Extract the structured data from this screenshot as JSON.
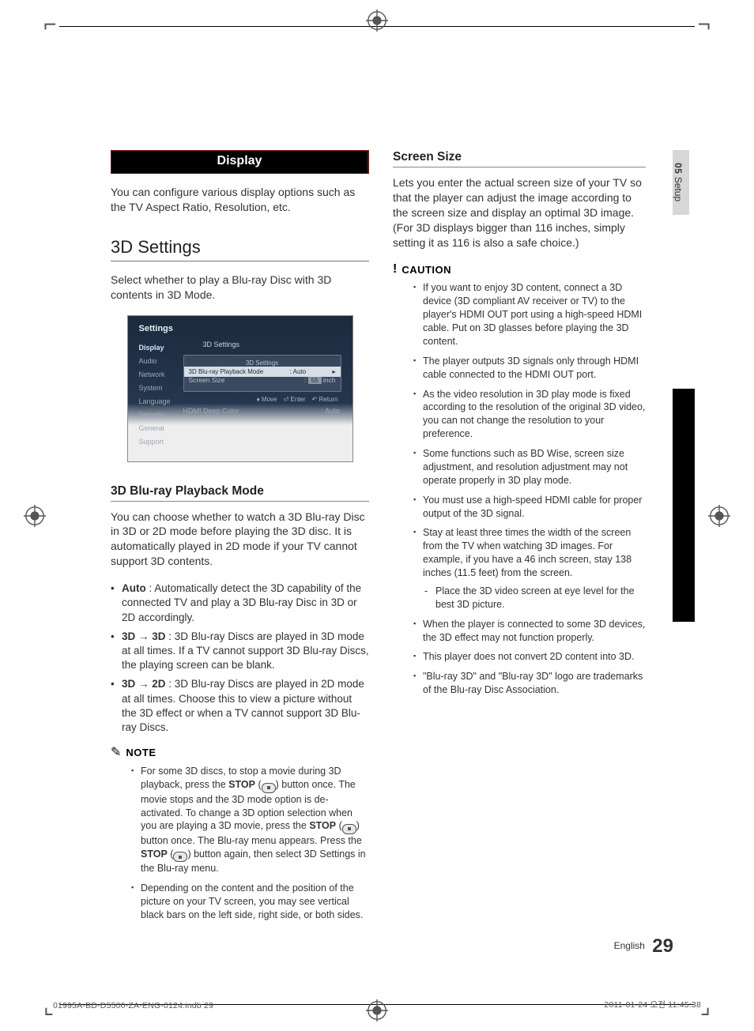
{
  "chapter": {
    "num": "05",
    "name": "Setup"
  },
  "left": {
    "banner": "Display",
    "intro": "You can configure various display options such as the TV Aspect Ratio, Resolution, etc.",
    "h2": "3D Settings",
    "body1": "Select whether to play a Blu-ray Disc with 3D contents in 3D Mode.",
    "osd": {
      "title": "Settings",
      "nav": [
        "Display",
        "Audio",
        "Network",
        "System",
        "Language",
        "Security",
        "General",
        "Support"
      ],
      "crumb": "3D Settings",
      "panel_title": "3D Settings",
      "row1_label": "3D Blu-ray Playback Mode",
      "row1_value": ": Auto",
      "row2_label": "Screen Size",
      "row2_val": "55",
      "row2_unit": "inch",
      "hints": {
        "move": "Move",
        "enter": "Enter",
        "return": "Return"
      },
      "extra_label": "HDMI Deep Color",
      "extra_value": ": Auto"
    },
    "h3a": "3D Blu-ray Playback Mode",
    "body2": "You can choose whether to watch a 3D Blu-ray Disc in 3D or 2D mode before playing the 3D disc. It is automatically played in 2D mode if your TV cannot support 3D contents.",
    "bullets": [
      {
        "label": "Auto",
        "text": " : Automatically detect the 3D capability of the connected TV and play a 3D Blu-ray Disc in 3D or 2D accordingly."
      },
      {
        "label": "3D → 3D",
        "text": " : 3D Blu-ray Discs are played in 3D mode at all times. If a TV cannot support 3D Blu-ray Discs, the playing screen can be blank."
      },
      {
        "label": "3D → 2D",
        "text": " : 3D Blu-ray Discs are played in 2D mode at all times. Choose this to view a picture without the 3D effect or when a TV cannot support 3D Blu-ray Discs."
      }
    ],
    "note_label": "NOTE",
    "notes": [
      {
        "pre": "For some 3D discs, to stop a movie during 3D playback, press the ",
        "b1": "STOP",
        "mid1": " (",
        "btn1": true,
        "mid2": ") button once. The movie stops and the 3D mode option is de-activated. To change a 3D option selection when you are playing a 3D movie, press the ",
        "b2": "STOP",
        "mid3": " (",
        "btn2": true,
        "mid4": ") button once. The Blu-ray menu appears. Press the ",
        "b3": "STOP",
        "mid5": " (",
        "btn3": true,
        "mid6": ") button again, then select 3D Settings in the Blu-ray menu."
      },
      {
        "text": "Depending on the content and the position of the picture on your TV screen, you may see vertical black bars on the left side, right side, or both sides."
      }
    ]
  },
  "right": {
    "h3a": "Screen Size",
    "body1": "Lets you enter the actual screen size of your TV so that the player can adjust the image according to the screen size and display an optimal 3D image. (For 3D displays bigger than 116 inches, simply setting it as 116 is also a safe choice.)",
    "caution_label": "CAUTION",
    "cautions": [
      "If you want to enjoy 3D content, connect a 3D device (3D compliant AV receiver or TV) to the player's HDMI OUT port using a high-speed HDMI cable. Put on 3D glasses before playing the 3D content.",
      "The player outputs 3D signals only through HDMI cable connected to the HDMI OUT port.",
      "As the video resolution in 3D play mode is fixed according to the resolution of the original 3D video, you can not change the resolution to your preference.",
      "Some functions such as BD Wise, screen size adjustment, and resolution adjustment may not operate properly in 3D play mode.",
      "You must use a high-speed HDMI cable for proper output of the 3D signal.",
      "Stay at least three times the width of the screen from the TV when watching 3D images. For example, if you have a 46 inch screen, stay 138 inches (11.5 feet) from the screen.",
      "When the player is connected to some 3D devices, the 3D effect may not function properly.",
      "This player does not convert 2D content into 3D.",
      "\"Blu-ray 3D\" and \"Blu-ray 3D\" logo are trademarks of the Blu-ray Disc Association."
    ],
    "caution_sub": "Place the 3D video screen at eye level for the best 3D picture."
  },
  "footer": {
    "lang": "English",
    "page": "29",
    "indb": "01995A-BD-D5500-ZA-ENG-0124.indb   29",
    "timestamp": "2011-01-24   오전 11:45:38"
  }
}
